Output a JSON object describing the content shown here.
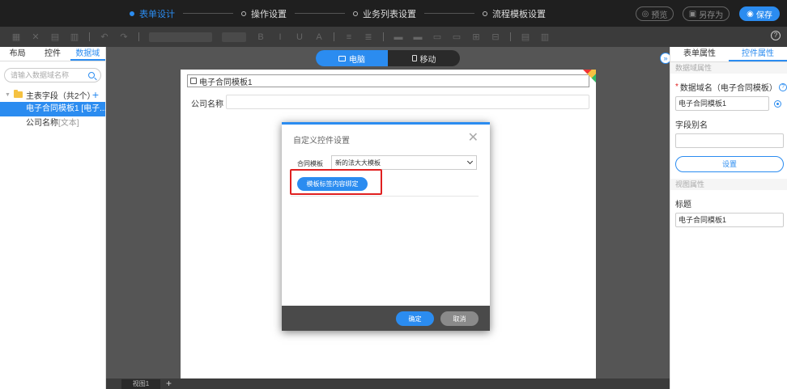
{
  "steps": [
    "表单设计",
    "操作设置",
    "业务列表设置",
    "流程模板设置"
  ],
  "top_buttons": {
    "preview": "预览",
    "save_as": "另存为",
    "save": "保存"
  },
  "left_panel": {
    "tabs": [
      "布局",
      "控件",
      "数据域"
    ],
    "search_placeholder": "请输入数据域名称",
    "tree_root": "主表字段（共2个）",
    "items": [
      {
        "label": "电子合同模板1 [电子...",
        "type": ""
      },
      {
        "label": "公司名称",
        "type": "[文本]"
      }
    ]
  },
  "device_switch": {
    "pc": "电脑",
    "mobile": "移动"
  },
  "form": {
    "title": "电子合同模板1",
    "field_label": "公司名称"
  },
  "bottom": {
    "view_tab": "视图1",
    "add": "+"
  },
  "modal": {
    "title": "自定义控件设置",
    "label": "合同模板",
    "selected": "新的法大大模板",
    "bind_button": "模板标签内容绑定",
    "ok": "确定",
    "cancel": "取消"
  },
  "right_panel": {
    "tabs": [
      "表单属性",
      "控件属性"
    ],
    "section_data": "数据域属性",
    "field_name_label": "数据域名（电子合同模板）",
    "field_name_value": "电子合同模板1",
    "alias_label": "字段别名",
    "alias_value": "",
    "set_button": "设置",
    "section_view": "视图属性",
    "title_label": "标题",
    "title_value": "电子合同模板1"
  },
  "colors": {
    "accent": "#2b8cf0",
    "highlight": "#e02020"
  },
  "icons": [
    "edit-icon",
    "search-icon",
    "folder-icon",
    "plus-icon",
    "close-icon",
    "chevron-down-icon",
    "help-icon",
    "monitor-icon",
    "phone-icon"
  ]
}
